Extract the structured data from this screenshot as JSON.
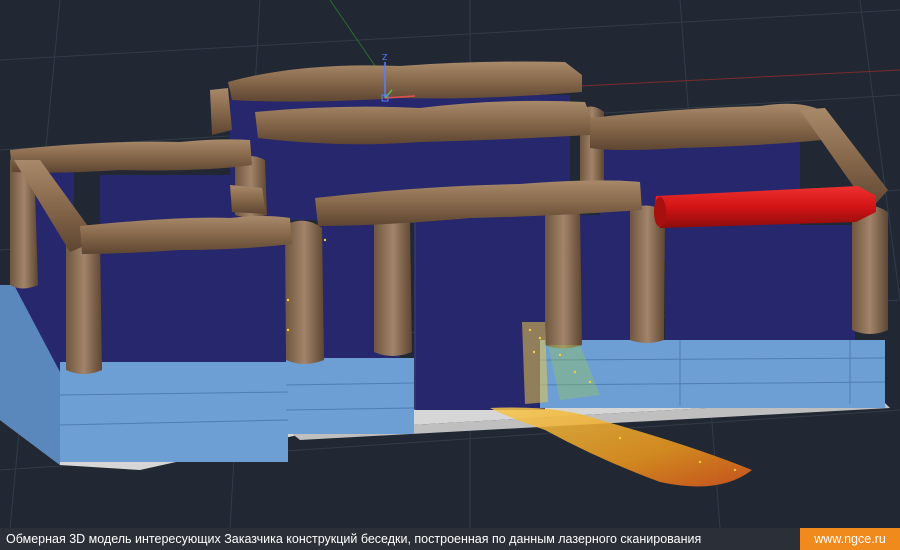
{
  "viewport": {
    "background": "#212833",
    "ucs_axis_label": "Z",
    "colors": {
      "logs": "#8a6b4d",
      "walls": "#27276e",
      "foundation": "#6d9fd4",
      "floor": "#d6d6d6",
      "highlighted_log": "#d21414",
      "point_cloud": "#f09a1c"
    }
  },
  "caption": {
    "text": "Обмерная 3D модель интересующих Заказчика конструкций беседки, построенная по данным лазерного сканирования",
    "link_label": "www.ngce.ru"
  }
}
